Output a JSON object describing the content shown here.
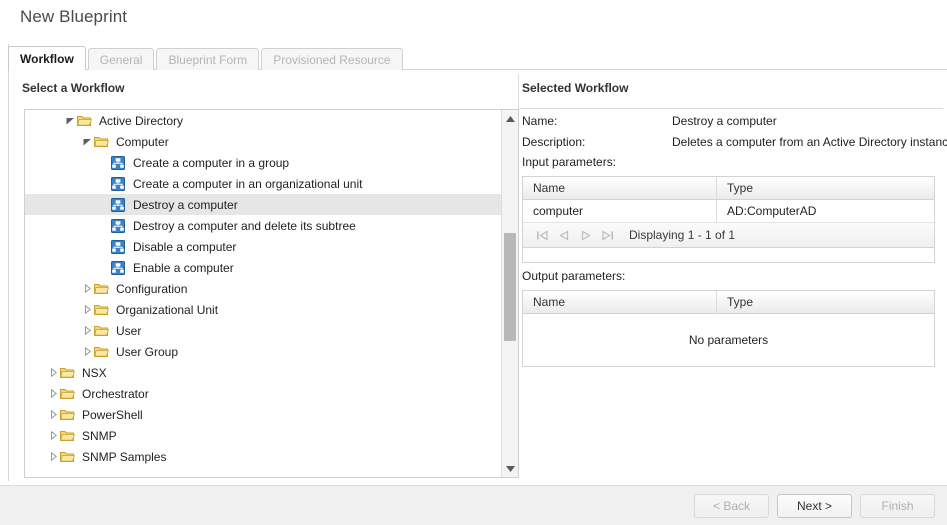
{
  "window": {
    "title": "New Blueprint"
  },
  "tabs": [
    {
      "label": "Workflow",
      "state": "active"
    },
    {
      "label": "General",
      "state": "disabled"
    },
    {
      "label": "Blueprint Form",
      "state": "disabled"
    },
    {
      "label": "Provisioned Resource",
      "state": "disabled"
    }
  ],
  "left_panel": {
    "heading": "Select a Workflow",
    "tree": [
      {
        "label": "Active Directory",
        "indent": 2,
        "icon": "folder-icon",
        "arrow": "expanded",
        "selected": false
      },
      {
        "label": "Computer",
        "indent": 3,
        "icon": "folder-icon",
        "arrow": "expanded",
        "selected": false
      },
      {
        "label": "Create a computer in a group",
        "indent": 4,
        "icon": "workflow-icon",
        "arrow": "none",
        "selected": false
      },
      {
        "label": "Create a computer in an organizational unit",
        "indent": 4,
        "icon": "workflow-icon",
        "arrow": "none",
        "selected": false
      },
      {
        "label": "Destroy a computer",
        "indent": 4,
        "icon": "workflow-icon",
        "arrow": "none",
        "selected": true
      },
      {
        "label": "Destroy a computer and delete its subtree",
        "indent": 4,
        "icon": "workflow-icon",
        "arrow": "none",
        "selected": false
      },
      {
        "label": "Disable a computer",
        "indent": 4,
        "icon": "workflow-icon",
        "arrow": "none",
        "selected": false
      },
      {
        "label": "Enable a computer",
        "indent": 4,
        "icon": "workflow-icon",
        "arrow": "none",
        "selected": false
      },
      {
        "label": "Configuration",
        "indent": 3,
        "icon": "folder-icon",
        "arrow": "collapsed",
        "selected": false
      },
      {
        "label": "Organizational Unit",
        "indent": 3,
        "icon": "folder-icon",
        "arrow": "collapsed",
        "selected": false
      },
      {
        "label": "User",
        "indent": 3,
        "icon": "folder-icon",
        "arrow": "collapsed",
        "selected": false
      },
      {
        "label": "User Group",
        "indent": 3,
        "icon": "folder-icon",
        "arrow": "collapsed",
        "selected": false
      },
      {
        "label": "NSX",
        "indent": 1,
        "icon": "folder-icon",
        "arrow": "collapsed",
        "selected": false
      },
      {
        "label": "Orchestrator",
        "indent": 1,
        "icon": "folder-icon",
        "arrow": "collapsed",
        "selected": false
      },
      {
        "label": "PowerShell",
        "indent": 1,
        "icon": "folder-icon",
        "arrow": "collapsed",
        "selected": false
      },
      {
        "label": "SNMP",
        "indent": 1,
        "icon": "folder-icon",
        "arrow": "collapsed",
        "selected": false
      },
      {
        "label": "SNMP Samples",
        "indent": 1,
        "icon": "folder-icon",
        "arrow": "collapsed",
        "selected": false
      }
    ],
    "scrollbar": {
      "up_icon": "scroll-up-icon",
      "down_icon": "scroll-down-icon"
    }
  },
  "right_panel": {
    "heading": "Selected Workflow",
    "name_label": "Name:",
    "name_value": "Destroy a computer",
    "description_label": "Description:",
    "description_value": "Deletes a computer from an Active Directory instance",
    "input_label": "Input parameters:",
    "output_label": "Output parameters:",
    "input_table": {
      "columns": [
        "Name",
        "Type"
      ],
      "rows": [
        {
          "name": "computer",
          "type": "AD:ComputerAD"
        }
      ],
      "pager": {
        "first_icon": "page-first-icon",
        "prev_icon": "page-prev-icon",
        "next_icon": "page-next-icon",
        "last_icon": "page-last-icon",
        "status": "Displaying 1 - 1 of 1"
      }
    },
    "output_table": {
      "columns": [
        "Name",
        "Type"
      ],
      "empty_text": "No parameters"
    }
  },
  "footer": {
    "back_label": "< Back",
    "next_label": "Next >",
    "finish_label": "Finish"
  },
  "colors": {
    "folder": "#f6d264",
    "workflow_icon": "#2f7fd0",
    "selected_row": "#e6e6e6",
    "footer_bg": "#f0f0f0",
    "border": "#cfcfcf"
  }
}
